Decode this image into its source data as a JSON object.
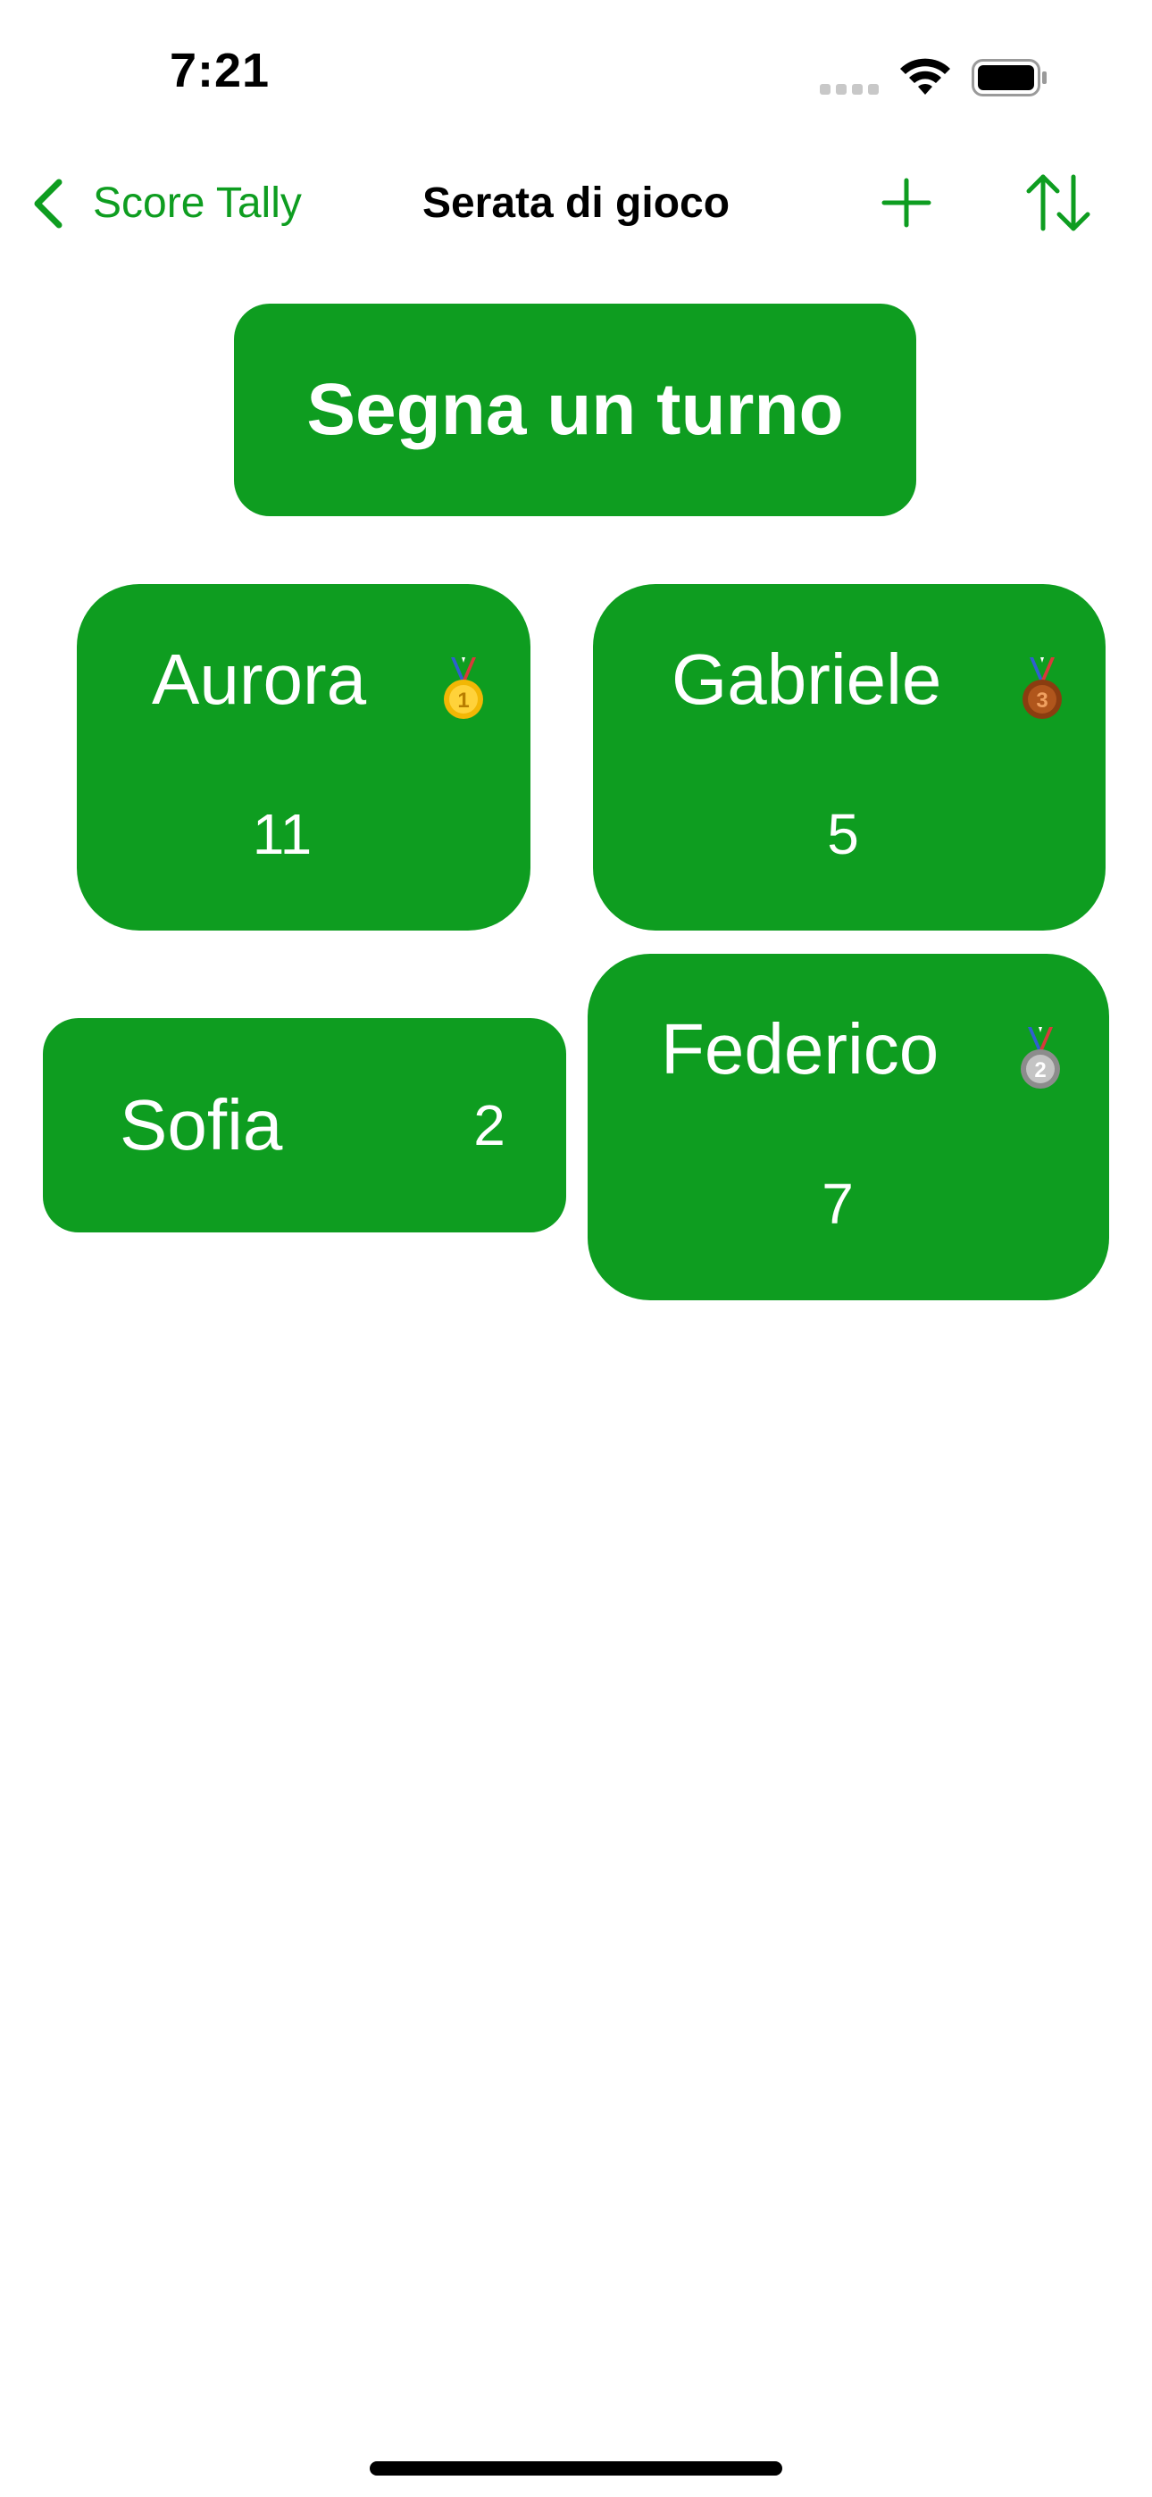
{
  "status_bar": {
    "time": "7:21"
  },
  "nav": {
    "back_label": "Score Tally",
    "title": "Serata di gioco",
    "add_icon": "plus-icon",
    "sort_icon": "sort-arrows-icon"
  },
  "main": {
    "action_label": "Segna un turno"
  },
  "players": [
    {
      "name": "Aurora",
      "score": "11",
      "medal": "gold",
      "medal_number": "1"
    },
    {
      "name": "Gabriele",
      "score": "5",
      "medal": "bronze",
      "medal_number": "3"
    },
    {
      "name": "Sofia",
      "score": "2",
      "medal": null
    },
    {
      "name": "Federico",
      "score": "7",
      "medal": "silver",
      "medal_number": "2"
    }
  ],
  "colors": {
    "accent": "#0e9d20",
    "card_text": "#ffffff",
    "gold": "#f2b705",
    "silver": "#a9a9a9",
    "bronze": "#b0561c"
  }
}
